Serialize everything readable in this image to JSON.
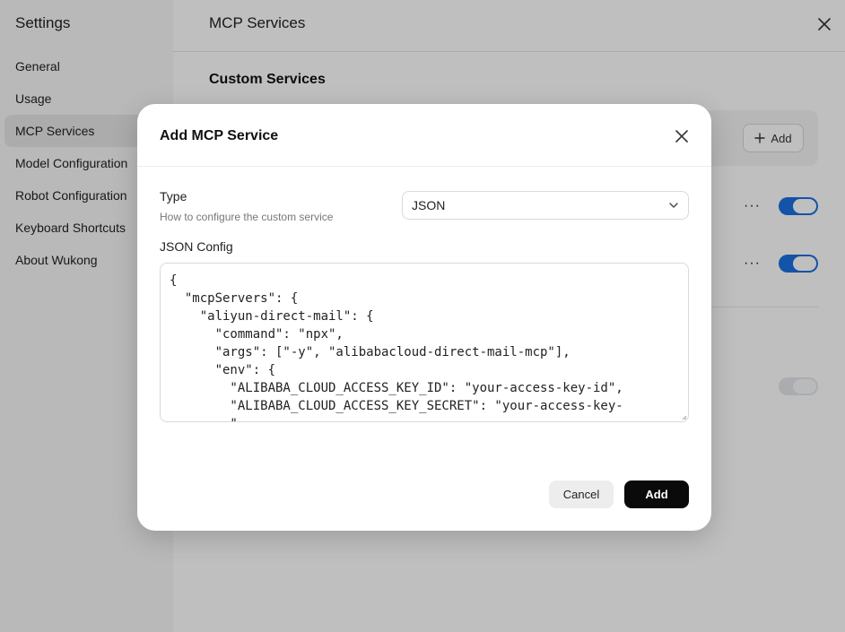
{
  "sidebar": {
    "title": "Settings",
    "items": [
      {
        "label": "General"
      },
      {
        "label": "Usage"
      },
      {
        "label": "MCP Services",
        "active": true
      },
      {
        "label": "Model Configuration"
      },
      {
        "label": "Robot Configuration"
      },
      {
        "label": "Keyboard Shortcuts"
      },
      {
        "label": "About Wukong"
      }
    ]
  },
  "main": {
    "title": "MCP Services",
    "section_title": "Custom Services",
    "add_button_label": "Add",
    "toggles": [
      {
        "dots": "···",
        "on": true
      },
      {
        "dots": "···",
        "on": true
      },
      {
        "on": false
      }
    ]
  },
  "modal": {
    "title": "Add MCP Service",
    "type_label": "Type",
    "type_description": "How to configure the custom service",
    "type_value": "JSON",
    "json_label": "JSON Config",
    "json_value": "{\n  \"mcpServers\": {\n    \"aliyun-direct-mail\": {\n      \"command\": \"npx\",\n      \"args\": [\"-y\", \"alibabacloud-direct-mail-mcp\"],\n      \"env\": {\n        \"ALIBABA_CLOUD_ACCESS_KEY_ID\": \"your-access-key-id\",\n        \"ALIBABA_CLOUD_ACCESS_KEY_SECRET\": \"your-access-key-\n        \"",
    "cancel_label": "Cancel",
    "add_label": "Add"
  },
  "colors": {
    "accent": "#1a6fe0",
    "primary_button": "#0a0a0a",
    "overlay": "rgba(0,0,0,0.25)"
  }
}
